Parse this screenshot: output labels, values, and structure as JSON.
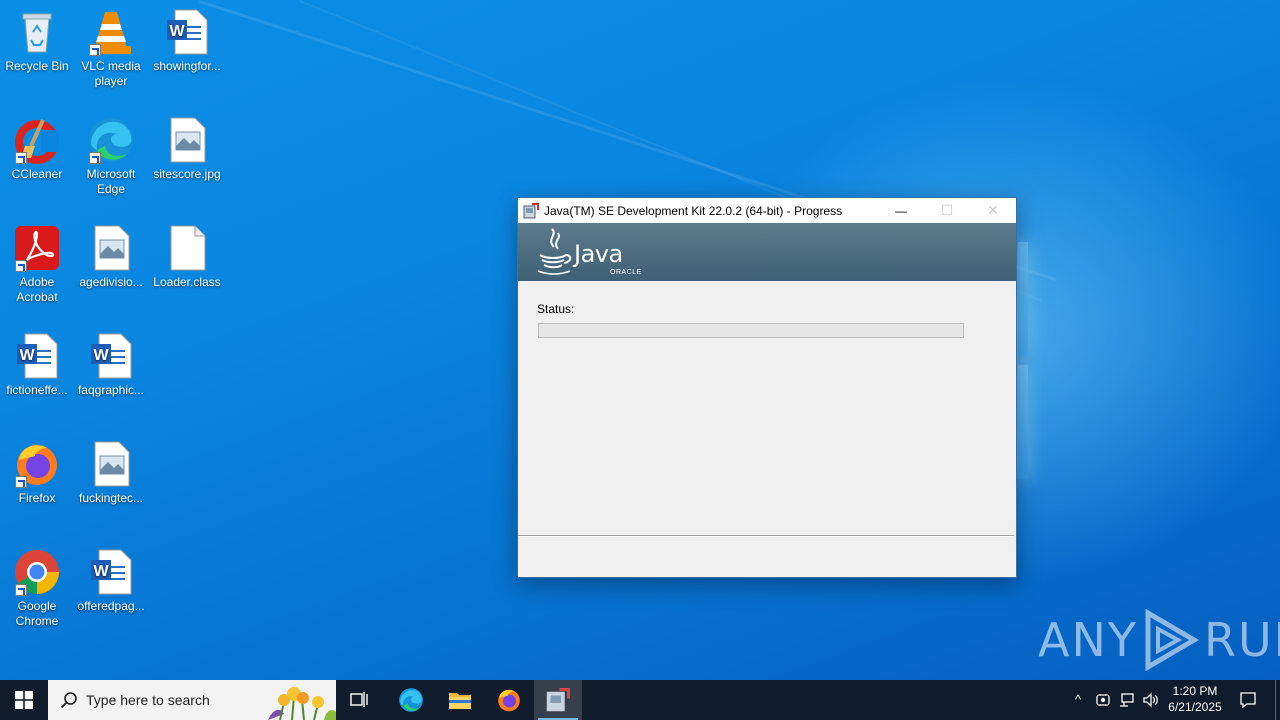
{
  "desktop": {
    "icons": [
      {
        "label": "Recycle Bin",
        "icon": "recycle-bin-icon"
      },
      {
        "label": "VLC media player",
        "icon": "vlc-icon"
      },
      {
        "label": "showingfor...",
        "icon": "word-document-icon"
      },
      {
        "label": "CCleaner",
        "icon": "ccleaner-icon"
      },
      {
        "label": "Microsoft Edge",
        "icon": "edge-icon"
      },
      {
        "label": "sitescore.jpg",
        "icon": "image-file-icon"
      },
      {
        "label": "Adobe Acrobat",
        "icon": "acrobat-icon"
      },
      {
        "label": "agedivisio...",
        "icon": "image-file-icon"
      },
      {
        "label": "Loader.class",
        "icon": "blank-file-icon"
      },
      {
        "label": "fictioneffe...",
        "icon": "word-document-icon"
      },
      {
        "label": "faqgraphic...",
        "icon": "word-document-icon"
      },
      {
        "label": "Firefox",
        "icon": "firefox-icon"
      },
      {
        "label": "fuckingtec...",
        "icon": "image-file-icon"
      },
      {
        "label": "Google Chrome",
        "icon": "chrome-icon"
      },
      {
        "label": "offeredpag...",
        "icon": "word-document-icon"
      }
    ]
  },
  "installer": {
    "title": "Java(TM) SE Development Kit 22.0.2 (64-bit) - Progress",
    "minimize_glyph": "—",
    "maximize_glyph": "☐",
    "close_glyph": "✕",
    "logo_word": "Java",
    "logo_sub": "ORACLE",
    "status_label": "Status:",
    "progress_fraction": 0
  },
  "taskbar": {
    "search_placeholder": "Type here to search",
    "clock_time": "1:20 PM",
    "clock_date": "6/21/2025",
    "tray_chevron": "^"
  },
  "watermark": {
    "text_left": "ANY",
    "text_right": "RUN"
  },
  "colors": {
    "taskbar": "#101c2b",
    "progress_fill": "#06b025",
    "java_banner": "#4a687c"
  }
}
